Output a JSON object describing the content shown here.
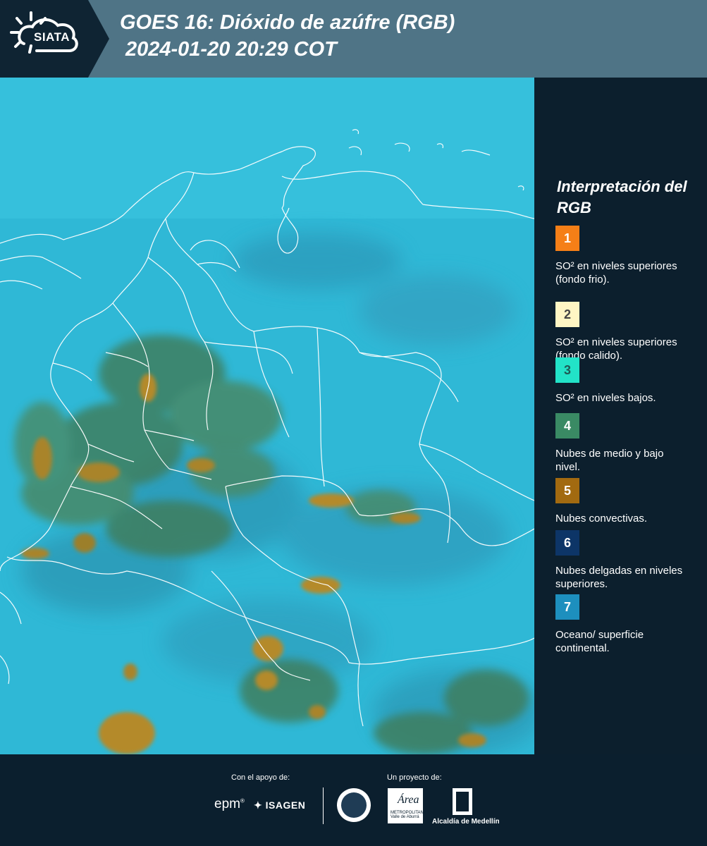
{
  "header": {
    "logo_text": "SIATA",
    "title_line1": "GOES 16: Dióxido de azúfre (RGB)",
    "title_line2": "2024-01-20 20:29 COT",
    "bg_color": "#4f7486"
  },
  "legend": {
    "title": "Interpretación del RGB",
    "items": [
      {
        "num": "1",
        "label": "SO² en niveles superiores (fondo frio).",
        "color": "#f57f17",
        "text_color": "#ffffff"
      },
      {
        "num": "2",
        "label": "SO² en niveles superiores (fondo calido).",
        "color": "#fff6c4",
        "text_color": "#444444"
      },
      {
        "num": "3",
        "label": "SO² en niveles bajos.",
        "color": "#22e3c8",
        "text_color": "#1f5a55"
      },
      {
        "num": "4",
        "label": "Nubes de medio y bajo nivel.",
        "color": "#3a8a64",
        "text_color": "#ffffff"
      },
      {
        "num": "5",
        "label": "Nubes convectivas.",
        "color": "#a26a10",
        "text_color": "#ffffff"
      },
      {
        "num": "6",
        "label": "Nubes delgadas en niveles superiores.",
        "color": "#0d3567",
        "text_color": "#ffffff"
      },
      {
        "num": "7",
        "label": "Oceano/ superficie continental.",
        "color": "#1d8fbe",
        "text_color": "#ffffff"
      }
    ]
  },
  "footer": {
    "support_label": "Con el apoyo de:",
    "project_label": "Un proyecto de:",
    "epm": "epm",
    "isagen": "ISAGEN",
    "area_text": "Área",
    "area_sub": "METROPOLITANA Valle de Aburrá",
    "alcaldia": "Alcaldía de Medellín"
  },
  "map": {
    "background_color": "#2fb8d6",
    "cloud_colors": [
      "#9c7f2c",
      "#3f7c58",
      "#b48a2a"
    ],
    "border_color": "#ffffff"
  }
}
